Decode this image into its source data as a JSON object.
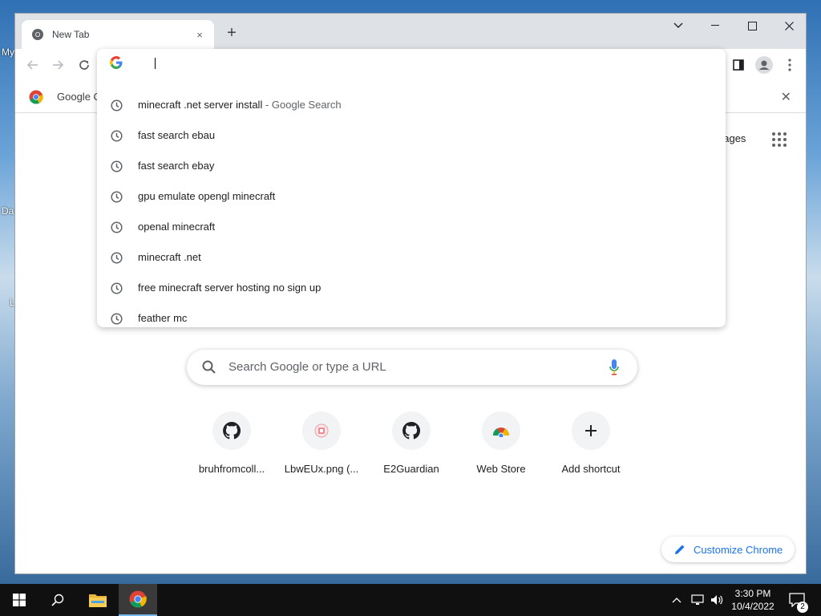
{
  "tab": {
    "title": "New Tab",
    "close": "×",
    "new_tab": "+"
  },
  "window_controls": {
    "dropdown": "⌄",
    "minimize": "–",
    "maximize": "☐",
    "close": "✕"
  },
  "bookmarks_bar": {
    "item_label": "Google C",
    "close": "✕"
  },
  "omnibox": {
    "suggestions": [
      {
        "text": "minecraft .net server install",
        "suffix": " - Google Search"
      },
      {
        "text": "fast search ebau",
        "suffix": ""
      },
      {
        "text": "fast search ebay",
        "suffix": ""
      },
      {
        "text": "gpu emulate opengl minecraft",
        "suffix": ""
      },
      {
        "text": "openal minecraft",
        "suffix": ""
      },
      {
        "text": "minecraft .net",
        "suffix": ""
      },
      {
        "text": "free minecraft server hosting no sign up",
        "suffix": ""
      },
      {
        "text": "feather mc",
        "suffix": ""
      }
    ]
  },
  "ntp": {
    "images_link": "nages",
    "search_placeholder": "Search Google or type a URL",
    "shortcuts": [
      {
        "label": "bruhfromcoll...",
        "icon": "github-icon"
      },
      {
        "label": "LbwEUx.png (...",
        "icon": "image-icon"
      },
      {
        "label": "E2Guardian",
        "icon": "github-icon"
      },
      {
        "label": "Web Store",
        "icon": "webstore-icon"
      },
      {
        "label": "Add shortcut",
        "icon": "plus-icon"
      }
    ],
    "customize_label": "Customize Chrome"
  },
  "desktop_fragments": {
    "a": "My",
    "b": "Da",
    "c": "L"
  },
  "taskbar": {
    "time": "3:30 PM",
    "date": "10/4/2022",
    "notifications": "2"
  },
  "colors": {
    "accent": "#1a73e8",
    "tab_strip": "#dee1e6",
    "taskbar": "#101010"
  }
}
